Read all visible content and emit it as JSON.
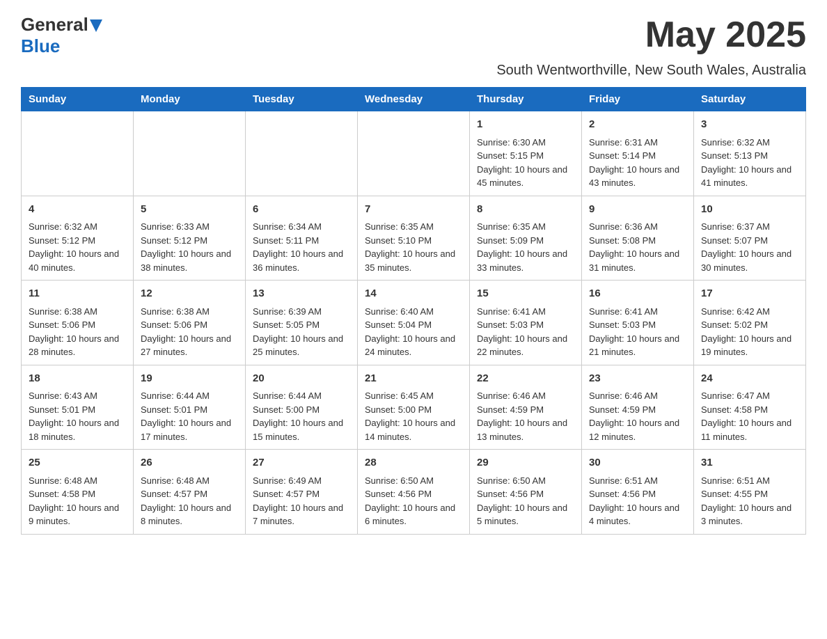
{
  "header": {
    "logo_general": "General",
    "logo_blue": "Blue",
    "month_title": "May 2025",
    "location": "South Wentworthville, New South Wales, Australia"
  },
  "days_of_week": [
    "Sunday",
    "Monday",
    "Tuesday",
    "Wednesday",
    "Thursday",
    "Friday",
    "Saturday"
  ],
  "weeks": [
    [
      {
        "day": "",
        "sunrise": "",
        "sunset": "",
        "daylight": ""
      },
      {
        "day": "",
        "sunrise": "",
        "sunset": "",
        "daylight": ""
      },
      {
        "day": "",
        "sunrise": "",
        "sunset": "",
        "daylight": ""
      },
      {
        "day": "",
        "sunrise": "",
        "sunset": "",
        "daylight": ""
      },
      {
        "day": "1",
        "sunrise": "Sunrise: 6:30 AM",
        "sunset": "Sunset: 5:15 PM",
        "daylight": "Daylight: 10 hours and 45 minutes."
      },
      {
        "day": "2",
        "sunrise": "Sunrise: 6:31 AM",
        "sunset": "Sunset: 5:14 PM",
        "daylight": "Daylight: 10 hours and 43 minutes."
      },
      {
        "day": "3",
        "sunrise": "Sunrise: 6:32 AM",
        "sunset": "Sunset: 5:13 PM",
        "daylight": "Daylight: 10 hours and 41 minutes."
      }
    ],
    [
      {
        "day": "4",
        "sunrise": "Sunrise: 6:32 AM",
        "sunset": "Sunset: 5:12 PM",
        "daylight": "Daylight: 10 hours and 40 minutes."
      },
      {
        "day": "5",
        "sunrise": "Sunrise: 6:33 AM",
        "sunset": "Sunset: 5:12 PM",
        "daylight": "Daylight: 10 hours and 38 minutes."
      },
      {
        "day": "6",
        "sunrise": "Sunrise: 6:34 AM",
        "sunset": "Sunset: 5:11 PM",
        "daylight": "Daylight: 10 hours and 36 minutes."
      },
      {
        "day": "7",
        "sunrise": "Sunrise: 6:35 AM",
        "sunset": "Sunset: 5:10 PM",
        "daylight": "Daylight: 10 hours and 35 minutes."
      },
      {
        "day": "8",
        "sunrise": "Sunrise: 6:35 AM",
        "sunset": "Sunset: 5:09 PM",
        "daylight": "Daylight: 10 hours and 33 minutes."
      },
      {
        "day": "9",
        "sunrise": "Sunrise: 6:36 AM",
        "sunset": "Sunset: 5:08 PM",
        "daylight": "Daylight: 10 hours and 31 minutes."
      },
      {
        "day": "10",
        "sunrise": "Sunrise: 6:37 AM",
        "sunset": "Sunset: 5:07 PM",
        "daylight": "Daylight: 10 hours and 30 minutes."
      }
    ],
    [
      {
        "day": "11",
        "sunrise": "Sunrise: 6:38 AM",
        "sunset": "Sunset: 5:06 PM",
        "daylight": "Daylight: 10 hours and 28 minutes."
      },
      {
        "day": "12",
        "sunrise": "Sunrise: 6:38 AM",
        "sunset": "Sunset: 5:06 PM",
        "daylight": "Daylight: 10 hours and 27 minutes."
      },
      {
        "day": "13",
        "sunrise": "Sunrise: 6:39 AM",
        "sunset": "Sunset: 5:05 PM",
        "daylight": "Daylight: 10 hours and 25 minutes."
      },
      {
        "day": "14",
        "sunrise": "Sunrise: 6:40 AM",
        "sunset": "Sunset: 5:04 PM",
        "daylight": "Daylight: 10 hours and 24 minutes."
      },
      {
        "day": "15",
        "sunrise": "Sunrise: 6:41 AM",
        "sunset": "Sunset: 5:03 PM",
        "daylight": "Daylight: 10 hours and 22 minutes."
      },
      {
        "day": "16",
        "sunrise": "Sunrise: 6:41 AM",
        "sunset": "Sunset: 5:03 PM",
        "daylight": "Daylight: 10 hours and 21 minutes."
      },
      {
        "day": "17",
        "sunrise": "Sunrise: 6:42 AM",
        "sunset": "Sunset: 5:02 PM",
        "daylight": "Daylight: 10 hours and 19 minutes."
      }
    ],
    [
      {
        "day": "18",
        "sunrise": "Sunrise: 6:43 AM",
        "sunset": "Sunset: 5:01 PM",
        "daylight": "Daylight: 10 hours and 18 minutes."
      },
      {
        "day": "19",
        "sunrise": "Sunrise: 6:44 AM",
        "sunset": "Sunset: 5:01 PM",
        "daylight": "Daylight: 10 hours and 17 minutes."
      },
      {
        "day": "20",
        "sunrise": "Sunrise: 6:44 AM",
        "sunset": "Sunset: 5:00 PM",
        "daylight": "Daylight: 10 hours and 15 minutes."
      },
      {
        "day": "21",
        "sunrise": "Sunrise: 6:45 AM",
        "sunset": "Sunset: 5:00 PM",
        "daylight": "Daylight: 10 hours and 14 minutes."
      },
      {
        "day": "22",
        "sunrise": "Sunrise: 6:46 AM",
        "sunset": "Sunset: 4:59 PM",
        "daylight": "Daylight: 10 hours and 13 minutes."
      },
      {
        "day": "23",
        "sunrise": "Sunrise: 6:46 AM",
        "sunset": "Sunset: 4:59 PM",
        "daylight": "Daylight: 10 hours and 12 minutes."
      },
      {
        "day": "24",
        "sunrise": "Sunrise: 6:47 AM",
        "sunset": "Sunset: 4:58 PM",
        "daylight": "Daylight: 10 hours and 11 minutes."
      }
    ],
    [
      {
        "day": "25",
        "sunrise": "Sunrise: 6:48 AM",
        "sunset": "Sunset: 4:58 PM",
        "daylight": "Daylight: 10 hours and 9 minutes."
      },
      {
        "day": "26",
        "sunrise": "Sunrise: 6:48 AM",
        "sunset": "Sunset: 4:57 PM",
        "daylight": "Daylight: 10 hours and 8 minutes."
      },
      {
        "day": "27",
        "sunrise": "Sunrise: 6:49 AM",
        "sunset": "Sunset: 4:57 PM",
        "daylight": "Daylight: 10 hours and 7 minutes."
      },
      {
        "day": "28",
        "sunrise": "Sunrise: 6:50 AM",
        "sunset": "Sunset: 4:56 PM",
        "daylight": "Daylight: 10 hours and 6 minutes."
      },
      {
        "day": "29",
        "sunrise": "Sunrise: 6:50 AM",
        "sunset": "Sunset: 4:56 PM",
        "daylight": "Daylight: 10 hours and 5 minutes."
      },
      {
        "day": "30",
        "sunrise": "Sunrise: 6:51 AM",
        "sunset": "Sunset: 4:56 PM",
        "daylight": "Daylight: 10 hours and 4 minutes."
      },
      {
        "day": "31",
        "sunrise": "Sunrise: 6:51 AM",
        "sunset": "Sunset: 4:55 PM",
        "daylight": "Daylight: 10 hours and 3 minutes."
      }
    ]
  ]
}
